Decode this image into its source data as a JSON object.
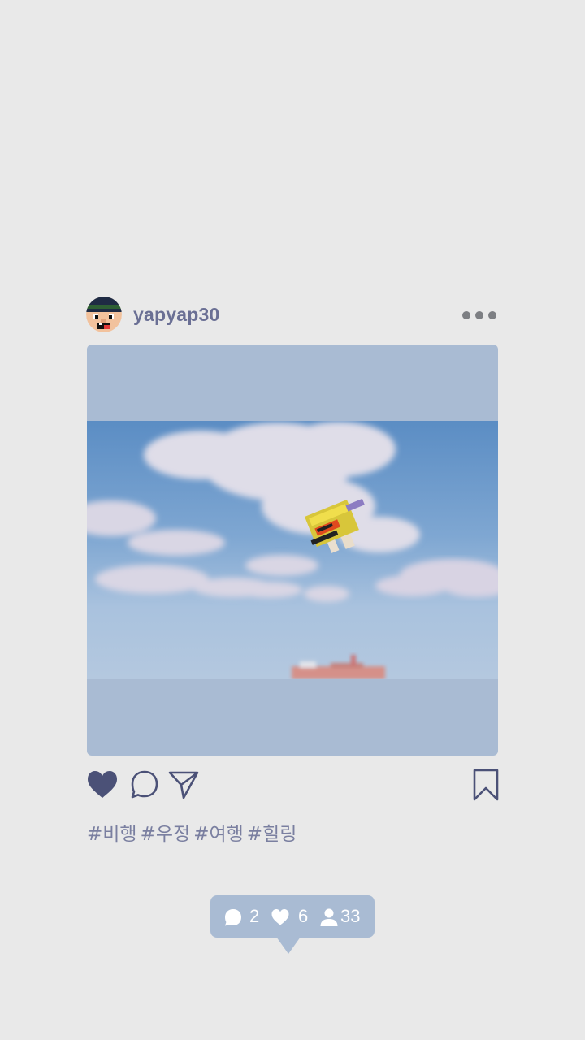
{
  "post": {
    "username": "yapyap30",
    "hashtags": [
      "#비행",
      "#우정",
      "#여행",
      "#힐링"
    ]
  },
  "icons": {
    "avatar": "pixel-face-avatar",
    "more": "more-dots-icon",
    "like": "heart-icon",
    "comment": "comment-bubble-icon",
    "share": "paper-plane-icon",
    "save": "bookmark-icon"
  },
  "stats": {
    "comments": "2",
    "likes": "6",
    "followers": "33"
  },
  "colors": {
    "background": "#e9e9e9",
    "accent": "#a9bbd3",
    "text": "#6a6f94",
    "icon": "#4b5177"
  }
}
